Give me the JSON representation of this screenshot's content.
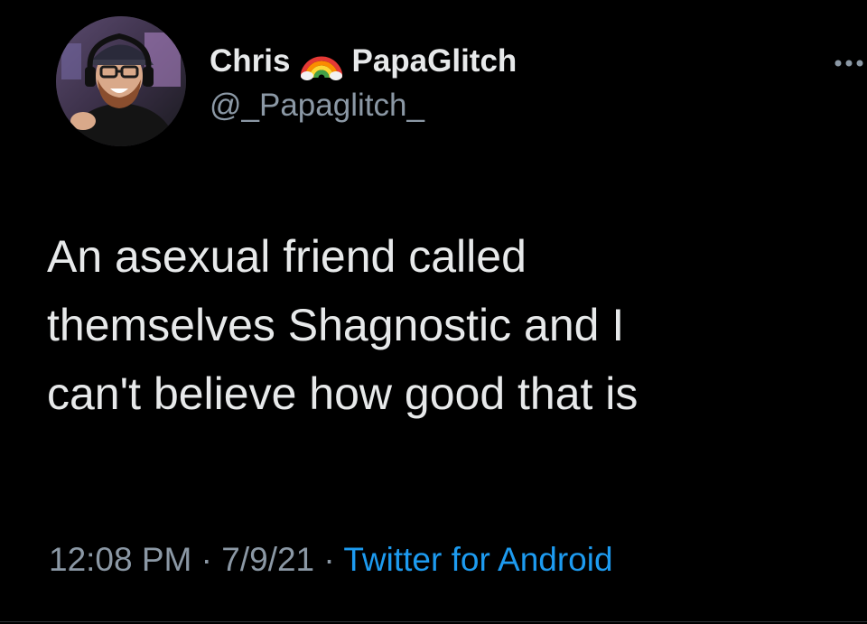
{
  "tweet": {
    "author": {
      "first_name": "Chris",
      "emoji": "rainbow",
      "last_name": "PapaGlitch",
      "handle": "@_Papaglitch_"
    },
    "more_icon": "more-horizontal-icon",
    "text_lines": [
      "An asexual friend called",
      "themselves Shagnostic and I",
      "can't believe how good that is"
    ],
    "meta": {
      "time": "12:08 PM",
      "separator": "·",
      "date": "7/9/21",
      "source": "Twitter for Android"
    }
  },
  "colors": {
    "background": "#000000",
    "primary_text": "#e7e9ea",
    "secondary_text": "#8b98a5",
    "link": "#1d9bf0"
  }
}
